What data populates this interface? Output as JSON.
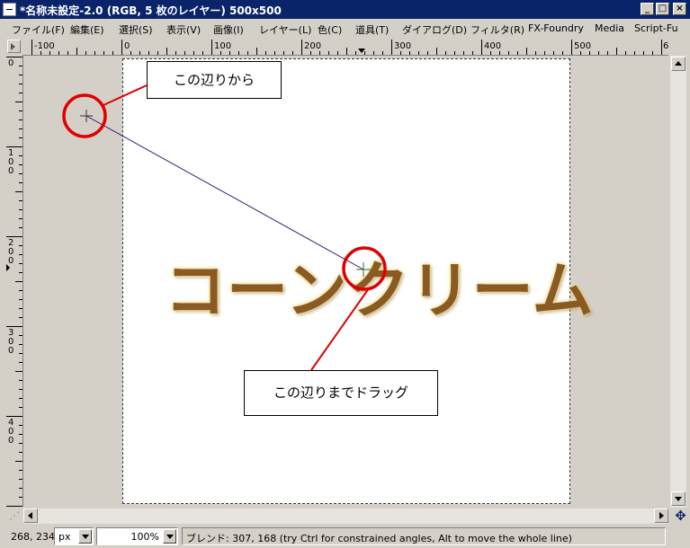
{
  "window": {
    "title": "*名称未設定-2.0 (RGB, 5 枚のレイヤー) 500x500",
    "controls": [
      "_",
      "□",
      "×"
    ]
  },
  "menu": [
    "ファイル(F)",
    "編集(E)",
    "選択(S)",
    "表示(V)",
    "画像(I)",
    "レイヤー(L)",
    "色(C)",
    "道具(T)",
    "ダイアログ(D)",
    "フィルタ(R)",
    "FX-Foundry",
    "Media",
    "Script-Fu"
  ],
  "rulers": {
    "horizontal_labels": [
      "-100",
      "0",
      "100",
      "200",
      "300",
      "400",
      "500",
      "6"
    ],
    "vertical_labels": [
      "0",
      "100",
      "200",
      "300",
      "400"
    ]
  },
  "canvas": {
    "image_text": "コーンクリーム",
    "text_color": "#8a5a22",
    "annotation_color": "#e00000",
    "callout_start": "この辺りから",
    "callout_end": "この辺りまでドラッグ"
  },
  "status": {
    "pointer_coords": "268, 234",
    "unit": "px",
    "zoom": "100%",
    "message": "ブレンド: 307, 168 (try Ctrl for constrained angles, Alt to move the whole line)"
  },
  "icons": {
    "quickmask": "quickmask-icon",
    "navigate": "navigate-icon",
    "ruler_menu": "ruler-menu-icon"
  }
}
